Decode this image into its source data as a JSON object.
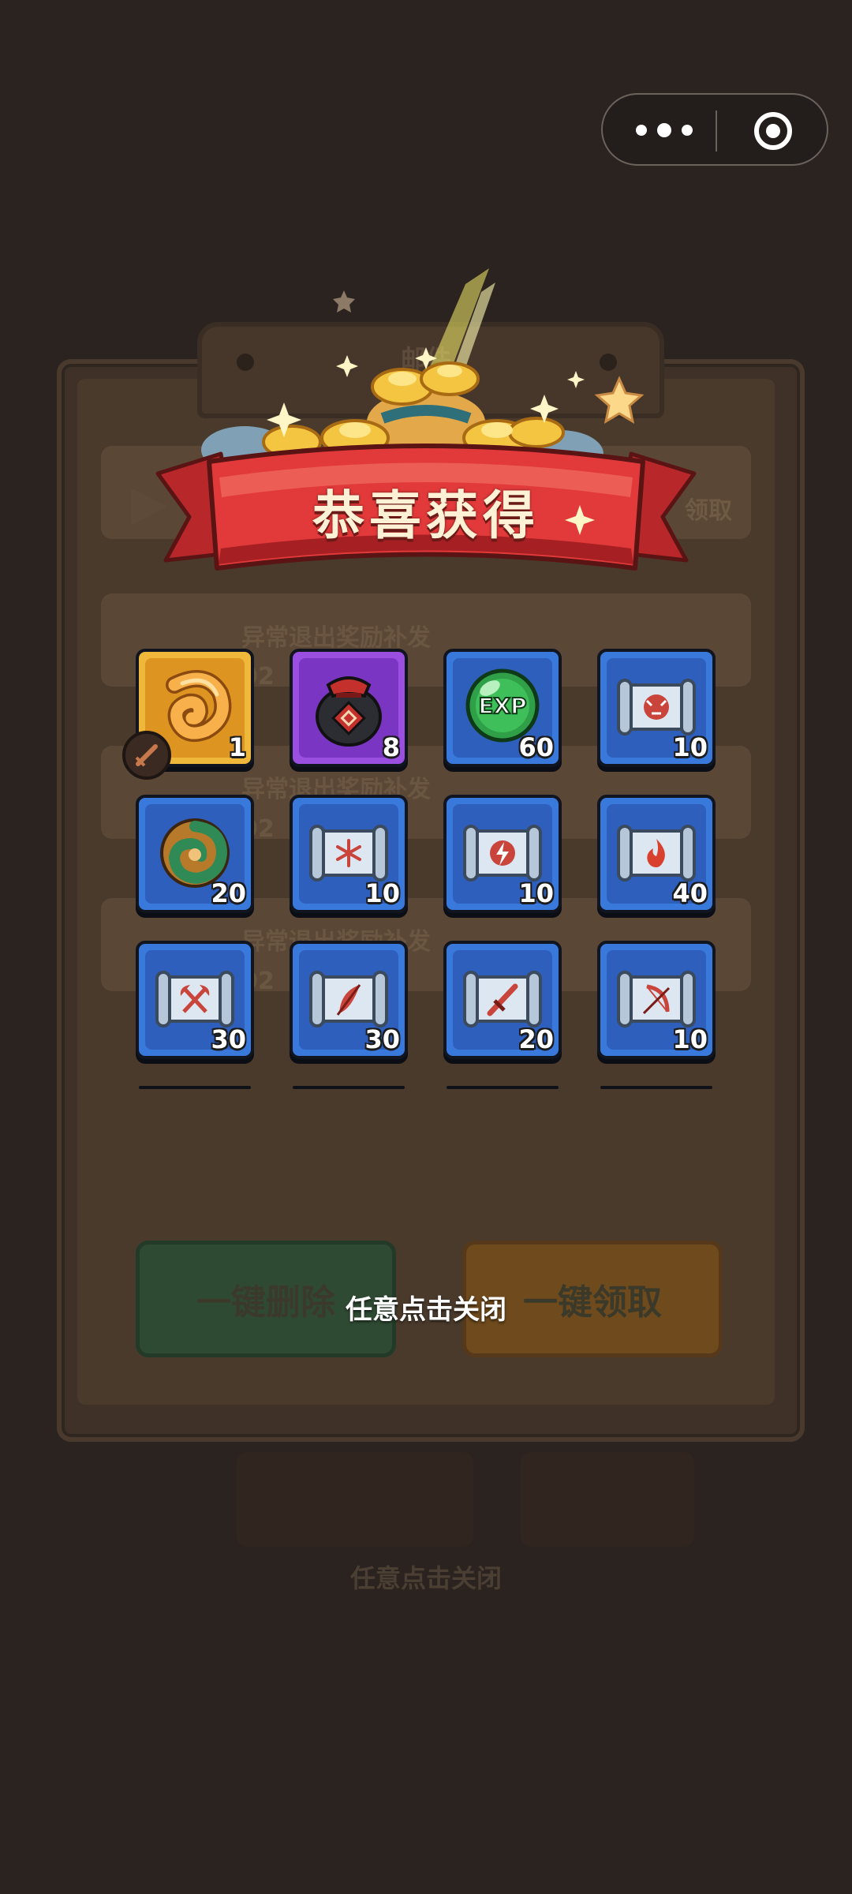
{
  "topbar": {
    "menu_icon": "more-dots-icon",
    "close_icon": "mini-program-close-icon"
  },
  "background": {
    "panel_title": "邮件",
    "rows": [
      {
        "title": "异常退出奖励补发",
        "date": "02"
      },
      {
        "title": "异常退出奖励补发",
        "date": "02"
      },
      {
        "title": "异常退出奖励补发",
        "date": "02"
      }
    ],
    "claim_label": "领取",
    "delete_all_label": "一键删除",
    "claim_all_label": "一键领取",
    "tap_close_label": "任意点击关闭"
  },
  "popup": {
    "title": "恭喜获得",
    "close_hint": "任意点击关闭",
    "items": [
      {
        "name": "horn",
        "count": "1",
        "frame": "gold",
        "icon": "golden-horn-icon"
      },
      {
        "name": "wine-jar",
        "count": "8",
        "frame": "purple",
        "icon": "wine-jar-icon"
      },
      {
        "name": "exp-orb",
        "count": "60",
        "frame": "blue",
        "icon": "exp-orb-icon",
        "label": "EXP"
      },
      {
        "name": "tiger-scroll",
        "count": "10",
        "frame": "blue",
        "icon": "tiger-scroll-icon"
      },
      {
        "name": "jade-swirl",
        "count": "20",
        "frame": "blue",
        "icon": "jade-swirl-icon"
      },
      {
        "name": "ice-scroll",
        "count": "10",
        "frame": "blue",
        "icon": "snowflake-scroll-icon"
      },
      {
        "name": "lightning-scroll",
        "count": "10",
        "frame": "blue",
        "icon": "lightning-scroll-icon"
      },
      {
        "name": "fire-scroll",
        "count": "40",
        "frame": "blue",
        "icon": "fire-scroll-icon"
      },
      {
        "name": "axe-scroll",
        "count": "30",
        "frame": "blue",
        "icon": "axe-scroll-icon"
      },
      {
        "name": "feather-scroll",
        "count": "30",
        "frame": "blue",
        "icon": "feather-scroll-icon"
      },
      {
        "name": "sword-scroll",
        "count": "20",
        "frame": "blue",
        "icon": "sword-scroll-icon"
      },
      {
        "name": "bow-scroll",
        "count": "10",
        "frame": "blue",
        "icon": "bow-scroll-icon"
      }
    ]
  }
}
